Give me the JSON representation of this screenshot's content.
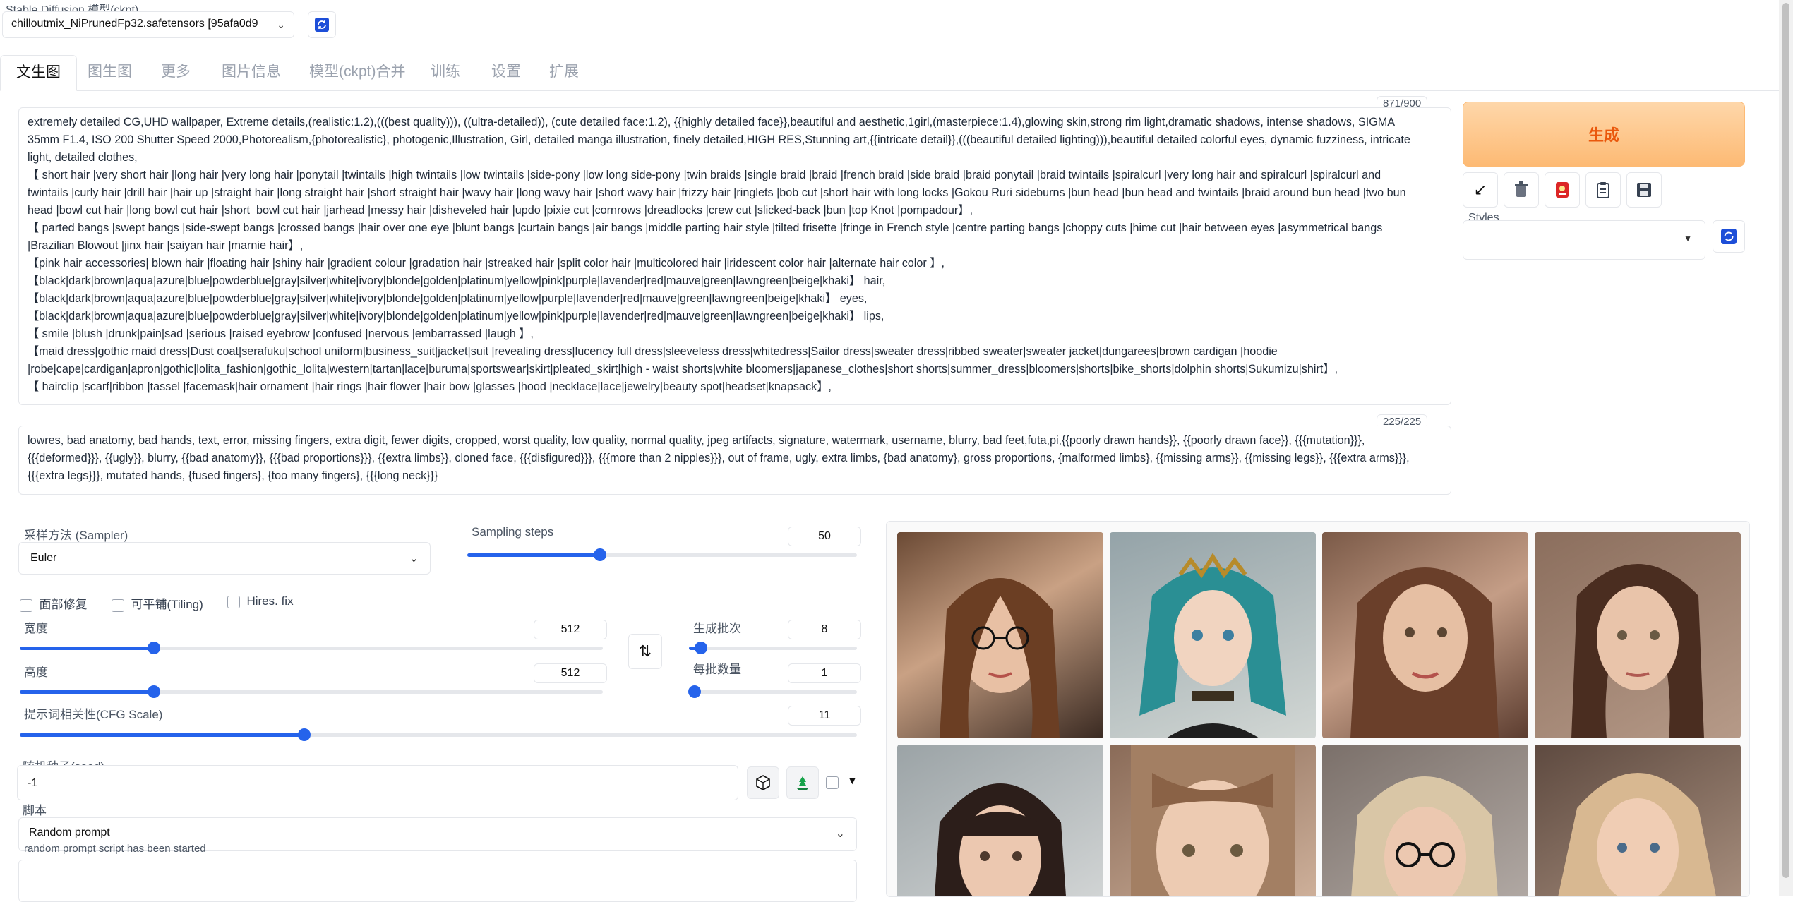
{
  "model": {
    "label": "Stable Diffusion 模型(ckpt)",
    "value": "chilloutmix_NiPrunedFp32.safetensors [95afa0d9"
  },
  "tabs": [
    "文生图",
    "图生图",
    "更多",
    "图片信息",
    "模型(ckpt)合并",
    "训练",
    "设置",
    "扩展"
  ],
  "prompt": {
    "counter": "871/900",
    "lines": [
      "extremely detailed CG,UHD wallpaper, Extreme details,(realistic:1.2),(((best quality))), ((ultra-detailed)), (cute detailed face:1.2), {{highly detailed face}},beautiful and aesthetic,1girl,(masterpiece:1.4),glowing skin,strong rim light,dramatic shadows, intense shadows, SIGMA",
      "35mm F1.4, ISO 200 Shutter Speed 2000,Photorealism,{photorealistic}, photogenic,Illustration, Girl, detailed manga illustration, finely detailed,HIGH RES,Stunning art,{{intricate detail}},(((beautiful detailed lighting))),beautiful detailed colorful eyes, dynamic fuzziness, intricate",
      "light, detailed clothes,",
      "【 short hair |very short hair |long hair |very long hair |ponytail |twintails |high twintails |low twintails |side-pony |low long side-pony |twin braids |single braid |braid |french braid |side braid |braid ponytail |braid twintails |spiralcurl |very long hair and spiralcurl |spiralcurl and",
      "twintails |curly hair |drill hair |hair up |straight hair |long straight hair |short straight hair |wavy hair |long wavy hair |short wavy hair |frizzy hair |ringlets |bob cut |short hair with long locks |Gokou Ruri sideburns |bun head |bun head and twintails |braid around bun head |two bun",
      "head |bowl cut hair |long bowl cut hair |short  bowl cut hair |jarhead |messy hair |disheveled hair |updo |pixie cut |cornrows |dreadlocks |crew cut |slicked-back |bun |top Knot |pompadour】,",
      "【 parted bangs |swept bangs |side-swept bangs |crossed bangs |hair over one eye |blunt bangs |curtain bangs |air bangs |middle parting hair style |tilted frisette |fringe in French style |centre parting bangs |choppy cuts |hime cut |hair between eyes |asymmetrical bangs",
      "|Brazilian Blowout |jinx hair |saiyan hair |marnie hair】,",
      "【pink hair accessories| blown hair |floating hair |shiny hair |gradient colour |gradation hair |streaked hair |split color hair |multicolored hair |iridescent color hair |alternate hair color 】,",
      "【black|dark|brown|aqua|azure|blue|powderblue|gray|silver|white|ivory|blonde|golden|platinum|yellow|pink|purple|lavender|red|mauve|green|lawngreen|beige|khaki】 hair,",
      "【black|dark|brown|aqua|azure|blue|powderblue|gray|silver|white|ivory|blonde|golden|platinum|yellow|purple|lavender|red|mauve|green|lawngreen|beige|khaki】 eyes,",
      "【black|dark|brown|aqua|azure|blue|powderblue|gray|silver|white|ivory|blonde|golden|platinum|yellow|pink|purple|lavender|red|mauve|green|lawngreen|beige|khaki】 lips,",
      "【 smile |blush |drunk|pain|sad |serious |raised eyebrow |confused |nervous |embarrassed |laugh 】,",
      "【maid dress|gothic maid dress|Dust coat|serafuku|school uniform|business_suit|jacket|suit |revealing dress|lucency full dress|sleeveless dress|whitedress|Sailor dress|sweater dress|ribbed sweater|sweater jacket|dungarees|brown cardigan |hoodie",
      "|robe|cape|cardigan|apron|gothic|lolita_fashion|gothic_lolita|western|tartan|lace|buruma|sportswear|skirt|pleated_skirt|high - waist shorts|white bloomers|japanese_clothes|short shorts|summer_dress|bloomers|shorts|bike_shorts|dolphin shorts|Sukumizu|shirt】,",
      "【 hairclip |scarf|ribbon |tassel |facemask|hair ornament |hair rings |hair flower |hair bow |glasses |hood |necklace|lace|jewelry|beauty spot|headset|knapsack】,"
    ]
  },
  "negative": {
    "counter": "225/225",
    "lines": [
      "lowres, bad anatomy, bad hands, text, error, missing fingers, extra digit, fewer digits, cropped, worst quality, low quality, normal quality, jpeg artifacts, signature, watermark, username, blurry, bad feet,futa,pi,{{poorly drawn hands}}, {{poorly drawn face}}, {{{mutation}}},",
      "{{{deformed}}}, {{ugly}}, blurry, {{bad anatomy}}, {{{bad proportions}}}, {{extra limbs}}, cloned face, {{{disfigured}}}, {{{more than 2 nipples}}}, out of frame, ugly, extra limbs, {bad anatomy}, gross proportions, {malformed limbs}, {{missing arms}}, {{missing legs}}, {{{extra arms}}},",
      "{{{extra legs}}}, mutated hands, {fused fingers}, {too many fingers}, {{{long neck}}}"
    ]
  },
  "generate_label": "生成",
  "styles_label": "Styles",
  "sampler": {
    "label": "采样方法 (Sampler)",
    "value": "Euler"
  },
  "steps": {
    "label": "Sampling steps",
    "value": "50",
    "fraction": 0.34
  },
  "checkboxes": [
    "面部修复",
    "可平铺(Tiling)",
    "Hires. fix"
  ],
  "width": {
    "label": "宽度",
    "value": "512",
    "fraction": 0.23
  },
  "height": {
    "label": "高度",
    "value": "512",
    "fraction": 0.23
  },
  "batch_count": {
    "label": "生成批次",
    "value": "8",
    "fraction": 0.07
  },
  "batch_size": {
    "label": "每批数量",
    "value": "1",
    "fraction": 0.0
  },
  "cfg": {
    "label": "提示词相关性(CFG Scale)",
    "value": "11",
    "fraction": 0.34
  },
  "seed": {
    "label": "随机种子(seed)",
    "value": "-1"
  },
  "script": {
    "label": "脚本",
    "value": "Random prompt",
    "note": "random prompt script has been started"
  },
  "colors": {
    "accent": "#2563eb",
    "generate_bg": "#fdba74",
    "generate_text": "#ea580c"
  }
}
